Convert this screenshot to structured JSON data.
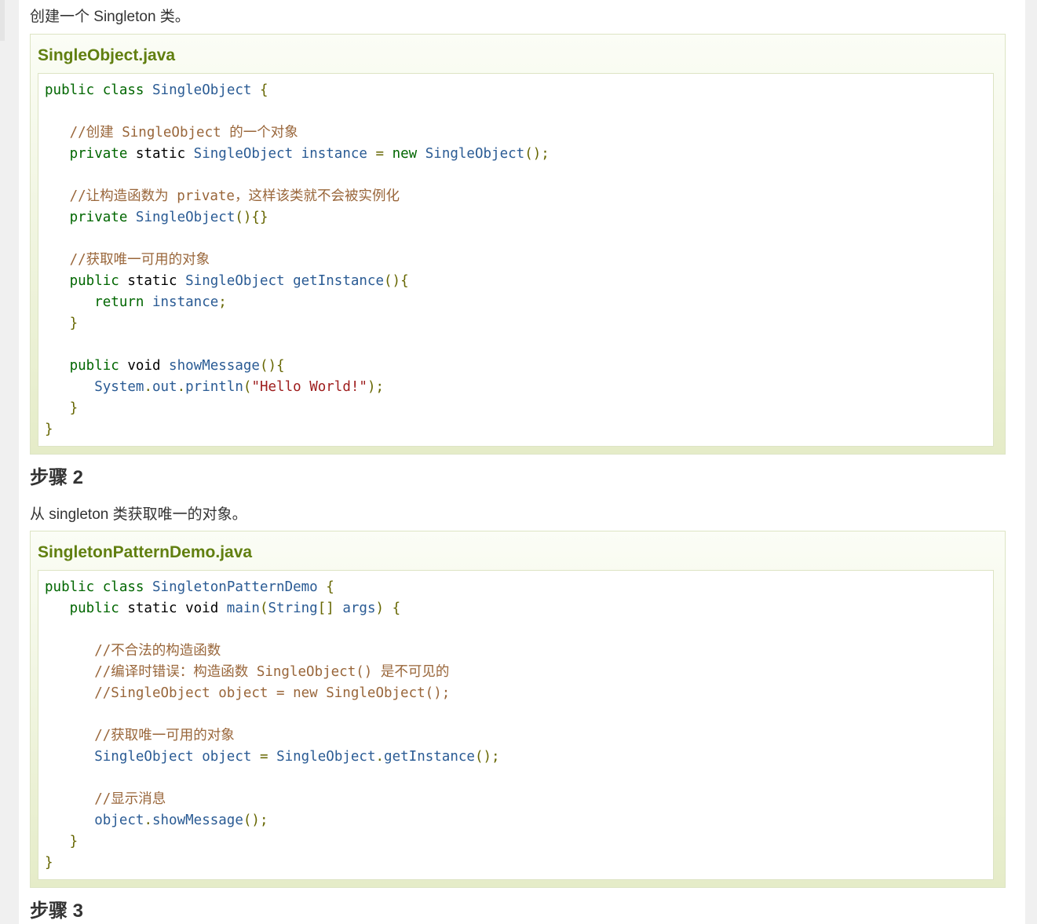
{
  "intro_text": "创建一个 Singleton 类。",
  "example1": {
    "title": "SingleObject.java",
    "lines": [
      [
        [
          "kwd",
          "public"
        ],
        [
          "pln",
          " "
        ],
        [
          "kwd",
          "class"
        ],
        [
          "pln",
          " "
        ],
        [
          "typ",
          "SingleObject"
        ],
        [
          "pln",
          " "
        ],
        [
          "pun",
          "{"
        ]
      ],
      [],
      [
        [
          "pln",
          "   "
        ],
        [
          "com",
          "//创建 "
        ],
        [
          "cid",
          "SingleObject"
        ],
        [
          "com",
          " 的一个对象"
        ]
      ],
      [
        [
          "pln",
          "   "
        ],
        [
          "kwd",
          "private"
        ],
        [
          "pln",
          " static "
        ],
        [
          "typ",
          "SingleObject"
        ],
        [
          "pln",
          " "
        ],
        [
          "typ",
          "instance"
        ],
        [
          "pln",
          " "
        ],
        [
          "pun",
          "="
        ],
        [
          "pln",
          " "
        ],
        [
          "kwd",
          "new"
        ],
        [
          "pln",
          " "
        ],
        [
          "typ",
          "SingleObject"
        ],
        [
          "pun",
          "();"
        ]
      ],
      [],
      [
        [
          "pln",
          "   "
        ],
        [
          "com",
          "//让构造函数为 "
        ],
        [
          "cid",
          "private"
        ],
        [
          "com",
          "，这样该类就不会被实例化"
        ]
      ],
      [
        [
          "pln",
          "   "
        ],
        [
          "kwd",
          "private"
        ],
        [
          "pln",
          " "
        ],
        [
          "typ",
          "SingleObject"
        ],
        [
          "pun",
          "(){}"
        ]
      ],
      [],
      [
        [
          "pln",
          "   "
        ],
        [
          "com",
          "//获取唯一可用的对象"
        ]
      ],
      [
        [
          "pln",
          "   "
        ],
        [
          "kwd",
          "public"
        ],
        [
          "pln",
          " static "
        ],
        [
          "typ",
          "SingleObject"
        ],
        [
          "pln",
          " "
        ],
        [
          "typ",
          "getInstance"
        ],
        [
          "pun",
          "(){"
        ]
      ],
      [
        [
          "pln",
          "      "
        ],
        [
          "kwd",
          "return"
        ],
        [
          "pln",
          " "
        ],
        [
          "typ",
          "instance"
        ],
        [
          "pun",
          ";"
        ]
      ],
      [
        [
          "pln",
          "   "
        ],
        [
          "pun",
          "}"
        ]
      ],
      [],
      [
        [
          "pln",
          "   "
        ],
        [
          "kwd",
          "public"
        ],
        [
          "pln",
          " void "
        ],
        [
          "typ",
          "showMessage"
        ],
        [
          "pun",
          "(){"
        ]
      ],
      [
        [
          "pln",
          "      "
        ],
        [
          "typ",
          "System"
        ],
        [
          "pun",
          "."
        ],
        [
          "typ",
          "out"
        ],
        [
          "pun",
          "."
        ],
        [
          "typ",
          "println"
        ],
        [
          "pun",
          "("
        ],
        [
          "str",
          "\"Hello World!\""
        ],
        [
          "pun",
          ");"
        ]
      ],
      [
        [
          "pln",
          "   "
        ],
        [
          "pun",
          "}"
        ]
      ],
      [
        [
          "pun",
          "}"
        ]
      ]
    ]
  },
  "step2": {
    "heading": "步骤 2",
    "text": "从 singleton 类获取唯一的对象。"
  },
  "example2": {
    "title": "SingletonPatternDemo.java",
    "lines": [
      [
        [
          "kwd",
          "public"
        ],
        [
          "pln",
          " "
        ],
        [
          "kwd",
          "class"
        ],
        [
          "pln",
          " "
        ],
        [
          "typ",
          "SingletonPatternDemo"
        ],
        [
          "pln",
          " "
        ],
        [
          "pun",
          "{"
        ]
      ],
      [
        [
          "pln",
          "   "
        ],
        [
          "kwd",
          "public"
        ],
        [
          "pln",
          " static void "
        ],
        [
          "typ",
          "main"
        ],
        [
          "pun",
          "("
        ],
        [
          "typ",
          "String"
        ],
        [
          "pun",
          "[]"
        ],
        [
          "pln",
          " "
        ],
        [
          "typ",
          "args"
        ],
        [
          "pun",
          ")"
        ],
        [
          "pln",
          " "
        ],
        [
          "pun",
          "{"
        ]
      ],
      [],
      [
        [
          "pln",
          "      "
        ],
        [
          "com",
          "//不合法的构造函数"
        ]
      ],
      [
        [
          "pln",
          "      "
        ],
        [
          "com",
          "//编译时错误：构造函数 "
        ],
        [
          "cid",
          "SingleObject()"
        ],
        [
          "com",
          " 是不可见的"
        ]
      ],
      [
        [
          "pln",
          "      "
        ],
        [
          "cid",
          "//SingleObject object = new SingleObject();"
        ]
      ],
      [],
      [
        [
          "pln",
          "      "
        ],
        [
          "com",
          "//获取唯一可用的对象"
        ]
      ],
      [
        [
          "pln",
          "      "
        ],
        [
          "typ",
          "SingleObject"
        ],
        [
          "pln",
          " "
        ],
        [
          "typ",
          "object"
        ],
        [
          "pln",
          " "
        ],
        [
          "pun",
          "="
        ],
        [
          "pln",
          " "
        ],
        [
          "typ",
          "SingleObject"
        ],
        [
          "pun",
          "."
        ],
        [
          "typ",
          "getInstance"
        ],
        [
          "pun",
          "();"
        ]
      ],
      [],
      [
        [
          "pln",
          "      "
        ],
        [
          "com",
          "//显示消息"
        ]
      ],
      [
        [
          "pln",
          "      "
        ],
        [
          "typ",
          "object"
        ],
        [
          "pun",
          "."
        ],
        [
          "typ",
          "showMessage"
        ],
        [
          "pun",
          "();"
        ]
      ],
      [
        [
          "pln",
          "   "
        ],
        [
          "pun",
          "}"
        ]
      ],
      [
        [
          "pun",
          "}"
        ]
      ]
    ]
  },
  "step3": {
    "heading": "步骤 3"
  }
}
